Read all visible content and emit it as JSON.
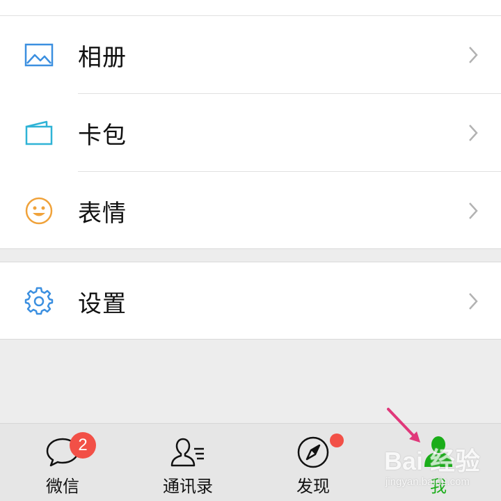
{
  "colors": {
    "accent_green": "#1aad19",
    "badge_red": "#f25047",
    "icon_blue": "#3b8fe0",
    "icon_teal": "#2fb3d6",
    "icon_orange": "#f0a23a",
    "arrow_magenta": "#e0387a"
  },
  "menu": {
    "group1": [
      {
        "label": "相册",
        "icon": "photo-album-icon"
      },
      {
        "label": "卡包",
        "icon": "card-wallet-icon"
      },
      {
        "label": "表情",
        "icon": "smiley-icon"
      }
    ],
    "group2": [
      {
        "label": "设置",
        "icon": "gear-icon"
      }
    ]
  },
  "tabbar": {
    "tabs": [
      {
        "label": "微信",
        "icon": "chat-bubble-icon",
        "badge": "2"
      },
      {
        "label": "通讯录",
        "icon": "contacts-icon"
      },
      {
        "label": "发现",
        "icon": "compass-icon",
        "dot": true
      },
      {
        "label": "我",
        "icon": "me-person-icon",
        "active": true
      }
    ]
  },
  "watermark": {
    "brand": "Bai 经验",
    "domain": "jingyan.baidu.com"
  }
}
